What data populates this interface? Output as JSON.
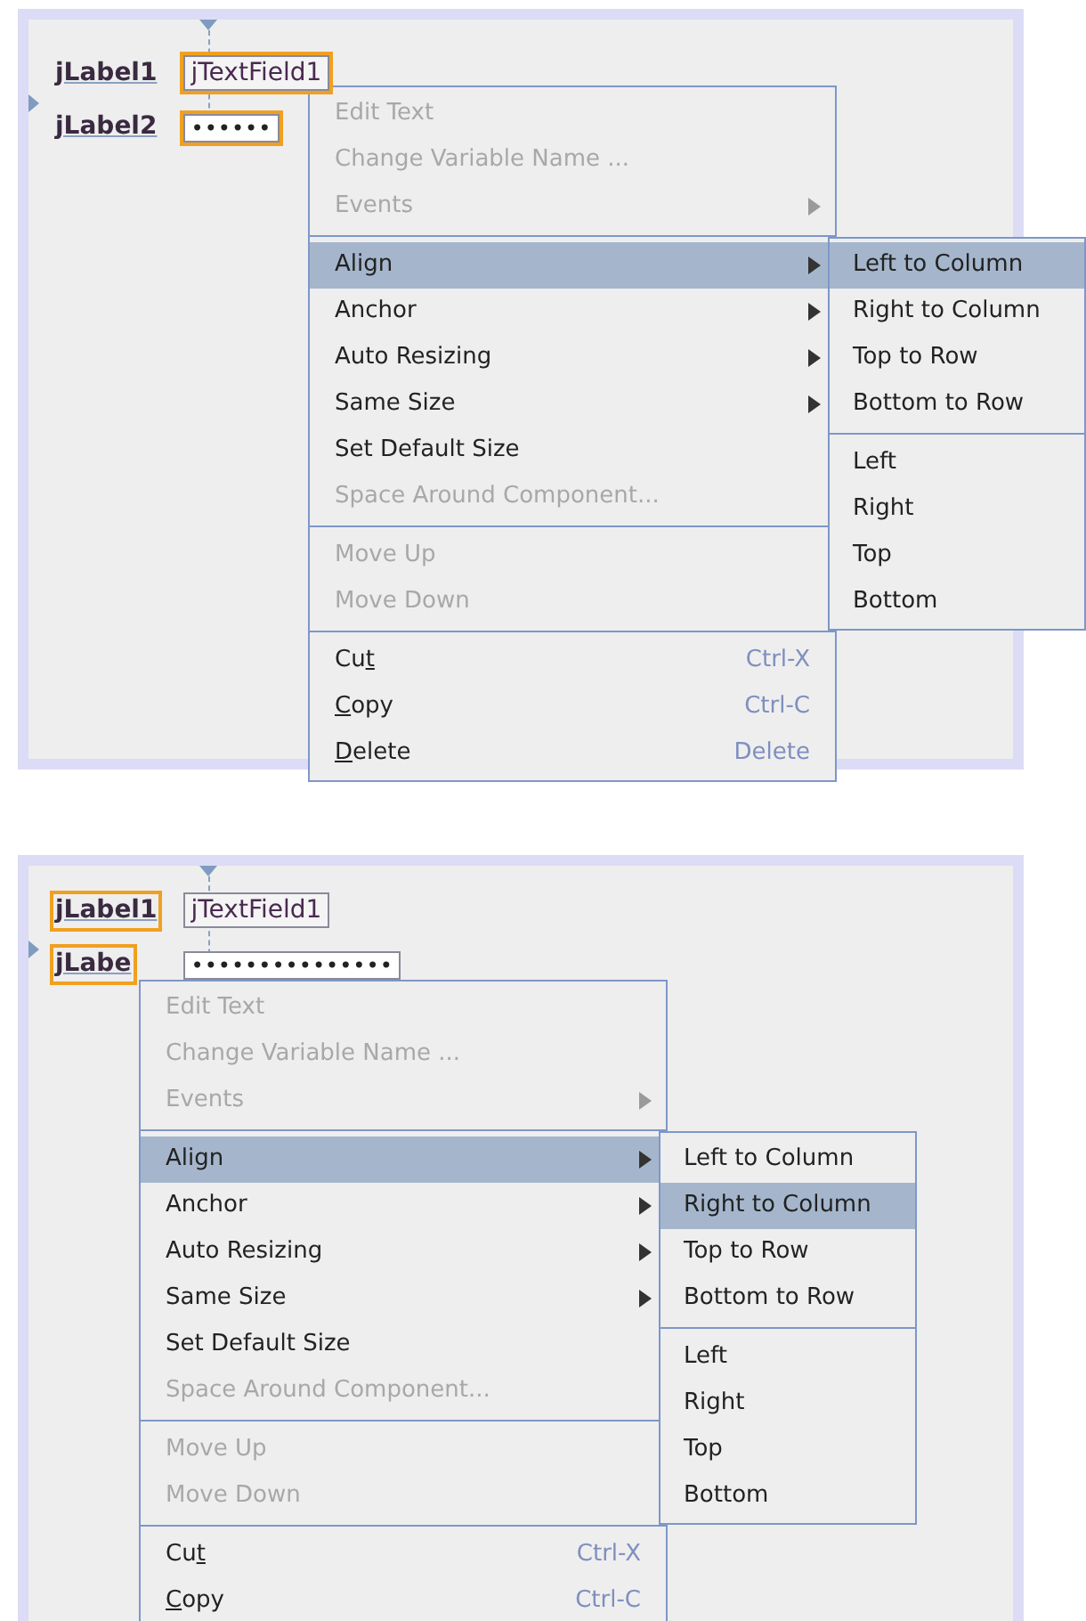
{
  "panels": [
    {
      "components": [
        {
          "kind": "label",
          "text": "jLabel1",
          "selected": false
        },
        {
          "kind": "textfield",
          "text": "jTextField1",
          "selected": true
        },
        {
          "kind": "label",
          "text": "jLabel2",
          "selected": false
        },
        {
          "kind": "password",
          "text": "••••••",
          "selected": true
        }
      ],
      "menu": [
        {
          "kind": "item",
          "label_pre": "Edit Text",
          "disabled": true,
          "submenu": false,
          "selected": false
        },
        {
          "kind": "item",
          "label_pre": "Change Variable Name ...",
          "disabled": true,
          "submenu": false,
          "selected": false
        },
        {
          "kind": "item",
          "label_pre": "Events",
          "disabled": true,
          "submenu": true,
          "selected": false
        },
        {
          "kind": "separator"
        },
        {
          "kind": "item",
          "label_pre": "Align",
          "disabled": false,
          "submenu": true,
          "selected": true
        },
        {
          "kind": "item",
          "label_pre": "Anchor",
          "disabled": false,
          "submenu": true,
          "selected": false
        },
        {
          "kind": "item",
          "label_pre": "Auto Resizing",
          "disabled": false,
          "submenu": true,
          "selected": false
        },
        {
          "kind": "item",
          "label_pre": "Same Size",
          "disabled": false,
          "submenu": true,
          "selected": false
        },
        {
          "kind": "item",
          "label_pre": "Set Default Size",
          "disabled": false,
          "submenu": false,
          "selected": false
        },
        {
          "kind": "item",
          "label_pre": "Space Around Component...",
          "disabled": true,
          "submenu": false,
          "selected": false
        },
        {
          "kind": "separator"
        },
        {
          "kind": "item",
          "label_pre": "Move Up",
          "disabled": true,
          "submenu": false,
          "selected": false
        },
        {
          "kind": "item",
          "label_pre": "Move Down",
          "disabled": true,
          "submenu": false,
          "selected": false
        },
        {
          "kind": "separator"
        },
        {
          "kind": "item",
          "label_pre": "Cu",
          "mnemonic": "t",
          "shortcut": "Ctrl-X",
          "disabled": false,
          "submenu": false,
          "selected": false
        },
        {
          "kind": "item",
          "mnemonic": "C",
          "label_post": "opy",
          "shortcut": "Ctrl-C",
          "disabled": false,
          "submenu": false,
          "selected": false
        },
        {
          "kind": "item",
          "mnemonic": "D",
          "label_post": "elete",
          "shortcut": "Delete",
          "disabled": false,
          "submenu": false,
          "selected": false
        }
      ],
      "submenu": [
        {
          "kind": "item",
          "label": "Left to Column",
          "selected": true
        },
        {
          "kind": "item",
          "label": "Right to Column",
          "selected": false
        },
        {
          "kind": "item",
          "label": "Top to Row",
          "selected": false
        },
        {
          "kind": "item",
          "label": "Bottom to Row",
          "selected": false
        },
        {
          "kind": "separator"
        },
        {
          "kind": "item",
          "label": "Left",
          "selected": false
        },
        {
          "kind": "item",
          "label": "Right",
          "selected": false
        },
        {
          "kind": "item",
          "label": "Top",
          "selected": false
        },
        {
          "kind": "item",
          "label": "Bottom",
          "selected": false
        }
      ]
    },
    {
      "components": [
        {
          "kind": "label",
          "text": "jLabel1",
          "selected": true
        },
        {
          "kind": "textfield",
          "text": "jTextField1",
          "selected": false
        },
        {
          "kind": "label",
          "text": "jLabe",
          "selected": true
        },
        {
          "kind": "password",
          "text": "•••••••••••••••",
          "selected": false
        }
      ],
      "menu": [
        {
          "kind": "item",
          "label_pre": "Edit Text",
          "disabled": true,
          "submenu": false,
          "selected": false
        },
        {
          "kind": "item",
          "label_pre": "Change Variable Name ...",
          "disabled": true,
          "submenu": false,
          "selected": false
        },
        {
          "kind": "item",
          "label_pre": "Events",
          "disabled": true,
          "submenu": true,
          "selected": false
        },
        {
          "kind": "separator"
        },
        {
          "kind": "item",
          "label_pre": "Align",
          "disabled": false,
          "submenu": true,
          "selected": true
        },
        {
          "kind": "item",
          "label_pre": "Anchor",
          "disabled": false,
          "submenu": true,
          "selected": false
        },
        {
          "kind": "item",
          "label_pre": "Auto Resizing",
          "disabled": false,
          "submenu": true,
          "selected": false
        },
        {
          "kind": "item",
          "label_pre": "Same Size",
          "disabled": false,
          "submenu": true,
          "selected": false
        },
        {
          "kind": "item",
          "label_pre": "Set Default Size",
          "disabled": false,
          "submenu": false,
          "selected": false
        },
        {
          "kind": "item",
          "label_pre": "Space Around Component...",
          "disabled": true,
          "submenu": false,
          "selected": false
        },
        {
          "kind": "separator"
        },
        {
          "kind": "item",
          "label_pre": "Move Up",
          "disabled": true,
          "submenu": false,
          "selected": false
        },
        {
          "kind": "item",
          "label_pre": "Move Down",
          "disabled": true,
          "submenu": false,
          "selected": false
        },
        {
          "kind": "separator"
        },
        {
          "kind": "item",
          "label_pre": "Cu",
          "mnemonic": "t",
          "shortcut": "Ctrl-X",
          "disabled": false,
          "submenu": false,
          "selected": false
        },
        {
          "kind": "item",
          "mnemonic": "C",
          "label_post": "opy",
          "shortcut": "Ctrl-C",
          "disabled": false,
          "submenu": false,
          "selected": false
        }
      ],
      "submenu": [
        {
          "kind": "item",
          "label": "Left to Column",
          "selected": false
        },
        {
          "kind": "item",
          "label": "Right to Column",
          "selected": true
        },
        {
          "kind": "item",
          "label": "Top to Row",
          "selected": false
        },
        {
          "kind": "item",
          "label": "Bottom to Row",
          "selected": false
        },
        {
          "kind": "separator"
        },
        {
          "kind": "item",
          "label": "Left",
          "selected": false
        },
        {
          "kind": "item",
          "label": "Right",
          "selected": false
        },
        {
          "kind": "item",
          "label": "Top",
          "selected": false
        },
        {
          "kind": "item",
          "label": "Bottom",
          "selected": false
        }
      ]
    }
  ]
}
